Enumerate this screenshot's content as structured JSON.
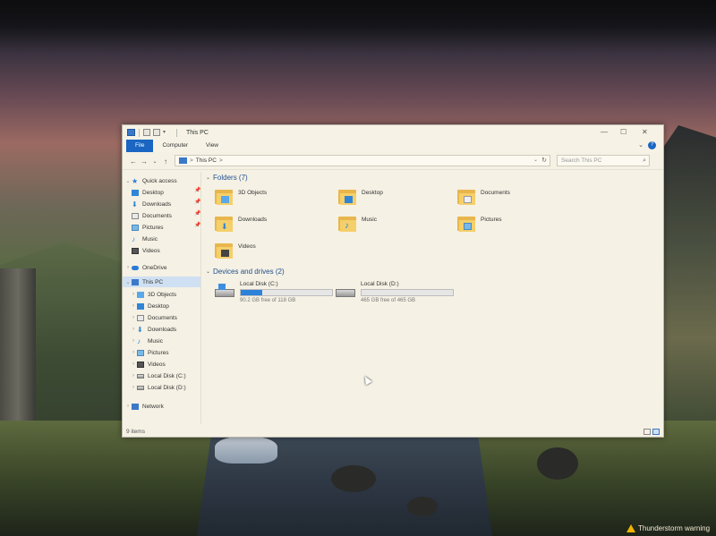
{
  "window": {
    "title": "This PC",
    "ribbon_tabs": [
      "File",
      "Computer",
      "View"
    ],
    "controls": {
      "minimize": "—",
      "maximize": "☐",
      "close": "✕"
    }
  },
  "navbar": {
    "back": "←",
    "forward": "→",
    "recent": "⌄",
    "up": "↑",
    "address": "This PC",
    "address_sep": ">",
    "search_placeholder": "Search This PC"
  },
  "sidebar": {
    "items": [
      {
        "label": "Quick access",
        "icon": "star-icon",
        "pinned": false
      },
      {
        "label": "Desktop",
        "icon": "desktop-folder-icon",
        "pinned": true
      },
      {
        "label": "Downloads",
        "icon": "downloads-icon",
        "pinned": true
      },
      {
        "label": "Documents",
        "icon": "documents-icon",
        "pinned": true
      },
      {
        "label": "Pictures",
        "icon": "pictures-icon",
        "pinned": true
      },
      {
        "label": "Music",
        "icon": "music-icon",
        "pinned": false
      },
      {
        "label": "Videos",
        "icon": "videos-icon",
        "pinned": false
      },
      {
        "label": "OneDrive",
        "icon": "cloud-icon",
        "pinned": false
      },
      {
        "label": "This PC",
        "icon": "computer-icon",
        "pinned": false
      },
      {
        "label": "3D Objects",
        "icon": "3d-objects-icon",
        "pinned": false
      },
      {
        "label": "Desktop",
        "icon": "desktop-folder-icon",
        "pinned": false
      },
      {
        "label": "Documents",
        "icon": "documents-icon",
        "pinned": false
      },
      {
        "label": "Downloads",
        "icon": "downloads-icon",
        "pinned": false
      },
      {
        "label": "Music",
        "icon": "music-icon",
        "pinned": false
      },
      {
        "label": "Pictures",
        "icon": "pictures-icon",
        "pinned": false
      },
      {
        "label": "Videos",
        "icon": "videos-icon",
        "pinned": false
      },
      {
        "label": "Local Disk (C:)",
        "icon": "drive-c-icon",
        "pinned": false
      },
      {
        "label": "Local Disk (D:)",
        "icon": "drive-icon",
        "pinned": false
      },
      {
        "label": "Network",
        "icon": "network-icon",
        "pinned": false
      }
    ]
  },
  "content": {
    "folders_header": "Folders (7)",
    "folders": [
      {
        "label": "3D Objects",
        "icon": "3d-objects-folder-icon"
      },
      {
        "label": "Desktop",
        "icon": "desktop-folder-icon"
      },
      {
        "label": "Documents",
        "icon": "documents-folder-icon"
      },
      {
        "label": "Downloads",
        "icon": "downloads-folder-icon"
      },
      {
        "label": "Music",
        "icon": "music-folder-icon"
      },
      {
        "label": "Pictures",
        "icon": "pictures-folder-icon"
      },
      {
        "label": "Videos",
        "icon": "videos-folder-icon"
      }
    ],
    "drives_header": "Devices and drives (2)",
    "drives": [
      {
        "label": "Local Disk (C:)",
        "free": "90.2 GB free of 118 GB",
        "used_fraction": 0.24
      },
      {
        "label": "Local Disk (D:)",
        "free": "465 GB free of 465 GB",
        "used_fraction": 0.0
      }
    ]
  },
  "statusbar": {
    "text": "9 items"
  },
  "taskbar": {
    "notification": "Thunderstorm warning"
  },
  "colors": {
    "accent": "#1a66c2",
    "folder": "#f5cf6a",
    "window_bg": "#f5f1e4",
    "drive_fill": "#2b82d8"
  }
}
